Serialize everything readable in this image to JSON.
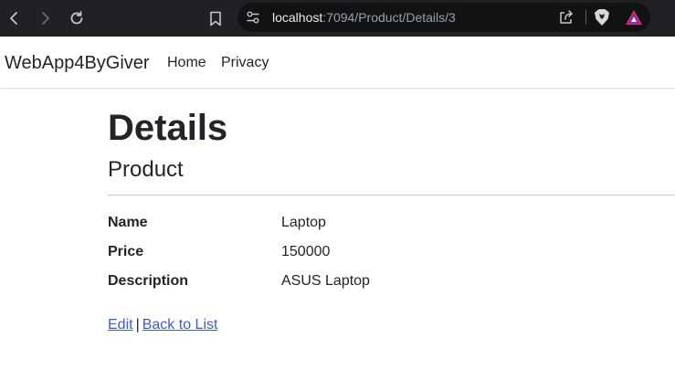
{
  "browser": {
    "url_host": "localhost",
    "url_path": ":7094/Product/Details/3"
  },
  "navbar": {
    "brand": "WebApp4ByGiver",
    "links": [
      "Home",
      "Privacy"
    ]
  },
  "page": {
    "title": "Details",
    "subtitle": "Product",
    "details": [
      {
        "term": "Name",
        "value": "Laptop"
      },
      {
        "term": "Price",
        "value": "150000"
      },
      {
        "term": "Description",
        "value": "ASUS Laptop"
      }
    ],
    "actions": {
      "edit": "Edit",
      "separator": "|",
      "back": "Back to List"
    }
  },
  "icons": {
    "back": "arrow-left-icon",
    "forward": "arrow-right-icon",
    "reload": "reload-icon",
    "bookmark": "bookmark-icon",
    "site_info": "site-settings-icon",
    "share": "share-icon",
    "brave": "brave-shield-icon",
    "rewards": "brave-rewards-icon"
  },
  "colors": {
    "chrome_bg": "#202124",
    "address_bg": "#111214",
    "link": "#3b5bdb",
    "text": "#212529"
  }
}
